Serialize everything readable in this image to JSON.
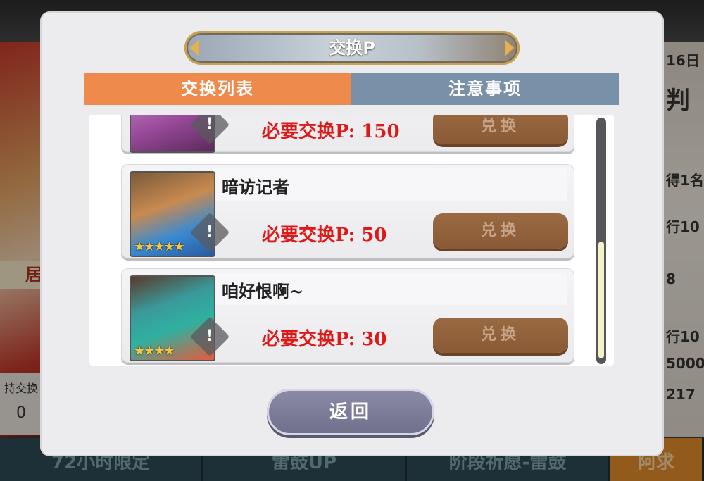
{
  "background": {
    "left_label": "居",
    "left_exchange_label": "持交换",
    "left_exchange_value": "0",
    "right_texts": [
      "16日",
      "判",
      "得1名",
      "行10",
      "8",
      "行10",
      "5000",
      "217"
    ],
    "bottom_tabs": [
      "72小时限定",
      "雷鼓UP",
      "阶段祈愿-雷鼓",
      "阿求"
    ]
  },
  "modal": {
    "title": "交换P",
    "tabs": {
      "exchange_list": "交换列表",
      "notes": "注意事项"
    },
    "items": [
      {
        "name": "",
        "cost": "必要交换P: 150",
        "button": "兑换",
        "stars": ""
      },
      {
        "name": "暗访记者",
        "cost": "必要交换P: 50",
        "button": "兑换",
        "stars": "★★★★★"
      },
      {
        "name": "咱好恨啊~",
        "cost": "必要交换P: 30",
        "button": "兑换",
        "stars": "★★★★"
      }
    ],
    "info_mark": "!",
    "back_button": "返回"
  }
}
